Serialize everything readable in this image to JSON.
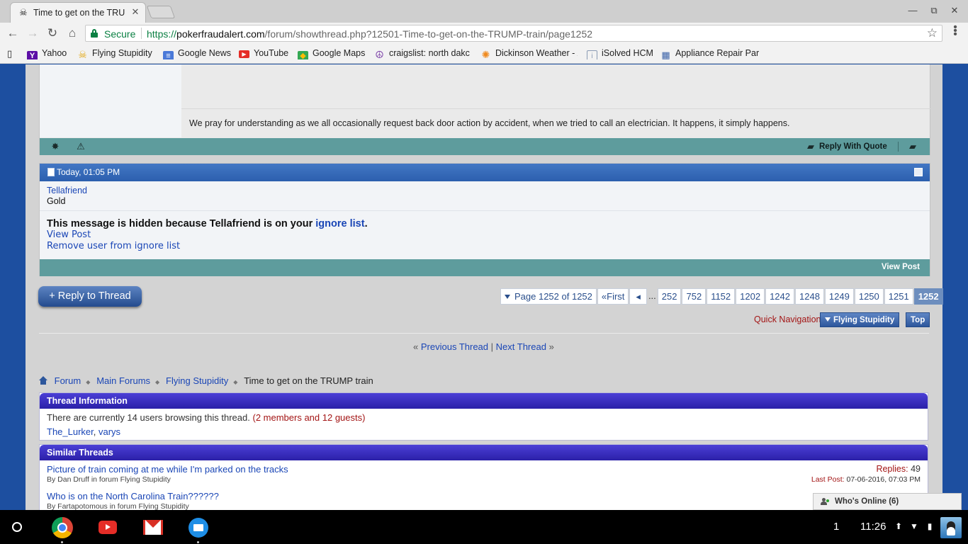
{
  "browser": {
    "tab": {
      "title": "Time to get on the TRUMP train",
      "favicon": "skull-crossbones-icon",
      "close": "✕"
    },
    "window_controls": {
      "minimize": "—",
      "maximize": "⧉",
      "close": "✕"
    },
    "nav": {
      "back": "←",
      "forward": "→",
      "reload": "↻",
      "home": "⌂"
    },
    "security_label": "Secure",
    "url_scheme": "https://",
    "url_host": "pokerfraudalert.com",
    "url_path": "/forum/showthread.php?12501-Time-to-get-on-the-TRUMP-train/page1252",
    "bookmark_star": "☆",
    "bookmarks": [
      {
        "label": "Yahoo",
        "icon": "yahoo-icon",
        "glyph": "Y",
        "color": "#5c0fa6"
      },
      {
        "label": "Flying Stupidity",
        "icon": "skull-icon",
        "glyph": "☠",
        "color": "#e3a712"
      },
      {
        "label": "Google News",
        "icon": "google-news-icon",
        "glyph": "≡",
        "color": "#4a79d8"
      },
      {
        "label": "YouTube",
        "icon": "youtube-icon",
        "glyph": "▶",
        "color": "#e52d27"
      },
      {
        "label": "Google Maps",
        "icon": "google-maps-icon",
        "glyph": "◆",
        "color": "#34a853"
      },
      {
        "label": "craigslist: north dakc",
        "icon": "peace-icon",
        "glyph": "☮",
        "color": "#7b3fa8"
      },
      {
        "label": "Dickinson Weather - /",
        "icon": "weather-sun-icon",
        "glyph": "✺",
        "color": "#f08a1e"
      },
      {
        "label": "iSolved HCM",
        "icon": "isolved-icon",
        "glyph": "i",
        "color": "#8a9bb3"
      },
      {
        "label": "Appliance Repair Par",
        "icon": "appliance-icon",
        "glyph": "▦",
        "color": "#3b62a8"
      }
    ]
  },
  "post_prev": {
    "signature": "We pray for understanding as we all occasionally request back door action by accident, when we tried to call an electrician. It happens, it simply happens.",
    "reply_with_quote": "Reply With Quote",
    "icons": [
      "gear-icon",
      "warning-icon",
      "quote-icon",
      "multiquote-icon"
    ]
  },
  "post_hidden": {
    "date": "Today, 01:05 PM",
    "username": "Tellafriend",
    "rank": "Gold",
    "hidden_prefix": "This message is hidden because Tellafriend is on your ",
    "ignore_list": "ignore list",
    "hidden_suffix": ".",
    "view_post": "View Post",
    "remove_user": "Remove user from ignore list",
    "footer_view_post": "View Post"
  },
  "reply_button": "+ Reply to Thread",
  "pagination": {
    "label": "Page 1252 of 1252",
    "first": "First",
    "first_icon": "«",
    "prev_icon": "◂",
    "ellipsis": "...",
    "pages": [
      "252",
      "752",
      "1152",
      "1202",
      "1242",
      "1248",
      "1249",
      "1250",
      "1251"
    ],
    "current": "1252"
  },
  "quick_nav": {
    "label": "Quick Navigation",
    "forum": "Flying Stupidity",
    "top": "Top"
  },
  "thread_nav": {
    "prev": "Previous Thread",
    "next": "Next Thread",
    "left": "«",
    "sep": "|",
    "right": "»"
  },
  "breadcrumb": {
    "items": [
      "Forum",
      "Main Forums",
      "Flying Stupidity"
    ],
    "current": "Time to get on the TRUMP train"
  },
  "thread_info": {
    "title": "Thread Information",
    "browsing": "There are currently 14 users browsing this thread.",
    "members_guests": "(2 members and 12 guests)",
    "users": [
      "The_Lurker",
      "varys"
    ]
  },
  "similar_threads": {
    "title": "Similar Threads",
    "items": [
      {
        "title": "Picture of train coming at me while I'm parked on the tracks",
        "by": "By Dan Druff in forum Flying Stupidity",
        "replies_label": "Replies:",
        "replies": "49",
        "last_label": "Last Post:",
        "last": "07-06-2016, 07:03 PM"
      },
      {
        "title": "Who is on the North Carolina Train??????",
        "by": "By Fartapotomous in forum Flying Stupidity"
      }
    ]
  },
  "whos_online": "Who's Online (6)",
  "shelf": {
    "apps": [
      "chrome-icon",
      "youtube-icon",
      "gmail-icon",
      "files-icon"
    ],
    "notification_count": "1",
    "time": "11:26"
  }
}
